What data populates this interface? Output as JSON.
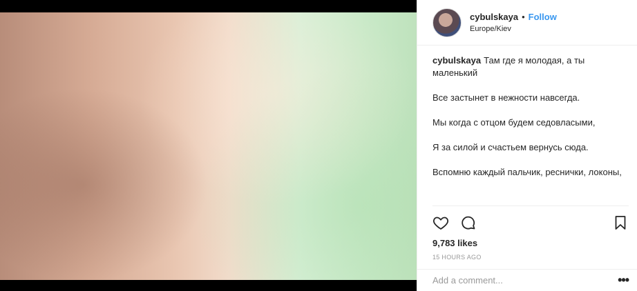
{
  "post": {
    "username": "cybulskaya",
    "separator": "•",
    "follow_label": "Follow",
    "location": "Europe/Kiev",
    "caption_user": "cybulskaya",
    "caption_lines": [
      "Там где я молодая, а ты маленький",
      "Все застынет в нежности навсегда.",
      "Мы когда с отцом будем седовласыми,",
      "Я за силой и счастьем вернусь сюда.",
      "Вспомню каждый пальчик, реснички, локоны,"
    ],
    "likes": "9,783 likes",
    "time": "15 HOURS AGO",
    "comment_placeholder": "Add a comment...",
    "more_label": "•••"
  },
  "icons": {
    "like": "heart-icon",
    "comment": "comment-bubble-icon",
    "save": "bookmark-icon",
    "more": "more-options-icon"
  },
  "colors": {
    "link": "#3897f0",
    "text": "#262626",
    "muted": "#999999",
    "border": "#efefef"
  }
}
